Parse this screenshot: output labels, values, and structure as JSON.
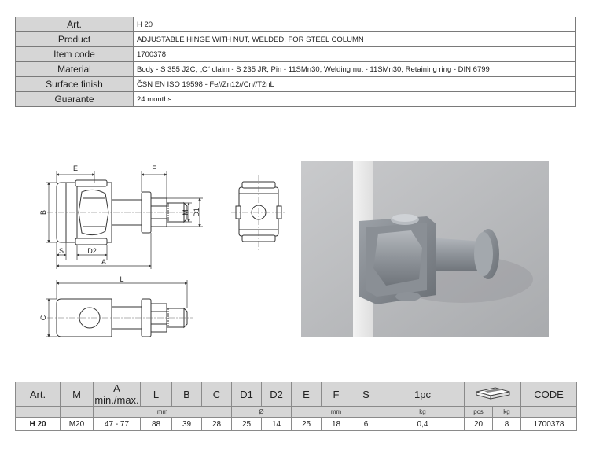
{
  "info": {
    "rows": [
      {
        "label": "Art.",
        "value": "H 20"
      },
      {
        "label": "Product",
        "value": "ADJUSTABLE HINGE WITH NUT, WELDED, FOR STEEL COLUMN"
      },
      {
        "label": "Item code",
        "value": "1700378"
      },
      {
        "label": "Material",
        "value": "Body - S 355 J2C, „C“ claim - S 235 JR, Pin - 11SMn30, Welding nut - 11SMn30, Retaining ring - DIN 6799"
      },
      {
        "label": "Surface finish",
        "value": "ČSN EN ISO 19598 - Fe//Zn12//Cn//T2nL"
      },
      {
        "label": "Guarante",
        "value": "24 months"
      }
    ]
  },
  "drawing": {
    "labels": {
      "E": "E",
      "F": "F",
      "B": "B",
      "M": "M",
      "D1": "D1",
      "S": "S",
      "D2": "D2",
      "A": "A",
      "L": "L",
      "C": "C"
    }
  },
  "spec": {
    "headers": [
      "Art.",
      "M",
      "A min./max.",
      "L",
      "B",
      "C",
      "D1",
      "D2",
      "E",
      "F",
      "S",
      "1pc",
      "",
      "CODE"
    ],
    "units": {
      "mm1": "mm",
      "diam": "Ø",
      "mm2": "mm",
      "kg": "kg",
      "pcs": "pcs",
      "kg2": "kg"
    },
    "row": [
      "H 20",
      "M20",
      "47 - 77",
      "88",
      "39",
      "28",
      "25",
      "14",
      "25",
      "18",
      "6",
      "0,4",
      "20",
      "8",
      "1700378"
    ]
  }
}
